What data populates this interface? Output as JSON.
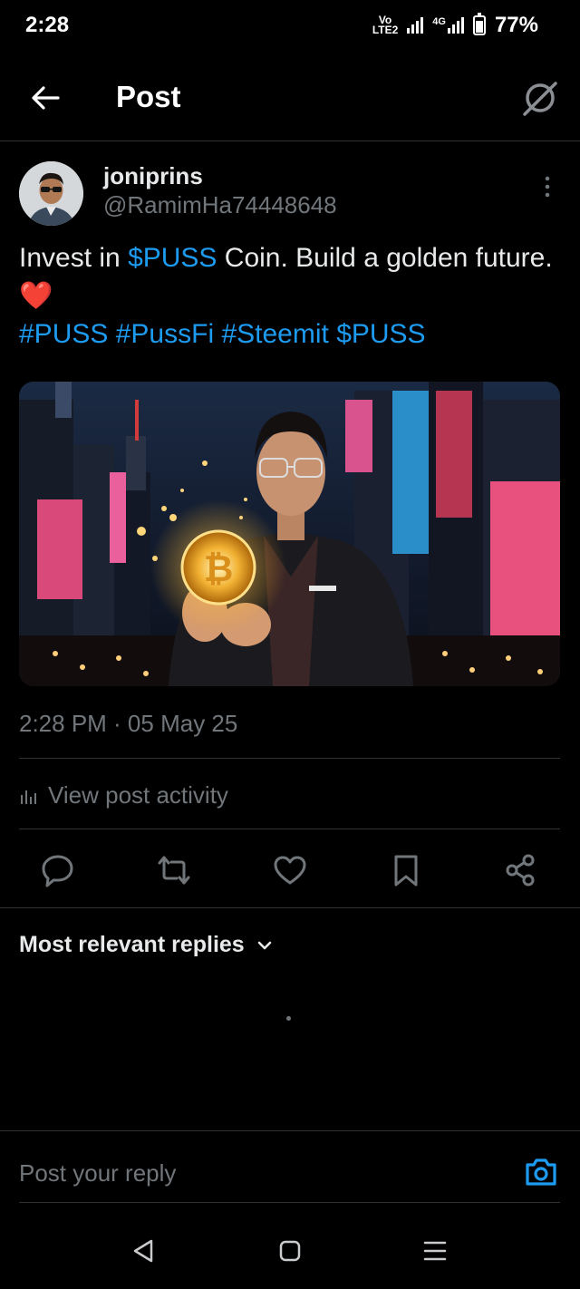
{
  "status_bar": {
    "time": "2:28",
    "network_label_top": "Vo",
    "network_label_bottom": "LTE2",
    "network_4g": "4G",
    "battery_text": "77%"
  },
  "header": {
    "title": "Post",
    "back_icon": "arrow-left-icon",
    "grok_icon": "grok-slash-icon"
  },
  "post": {
    "author_name": "joniprins",
    "author_handle": "@RamimHa74448648",
    "text_parts": {
      "p1": "Invest in ",
      "p2": "$PUSS",
      "p3": " Coin. Build a golden future.",
      "heart": "❤️",
      "tag1": "#PUSS",
      "tag2": "#PussFi",
      "tag3": "#Steemit",
      "tag4": "$PUSS"
    },
    "timestamp": "2:28 PM · 05 May 25",
    "activity_label": "View post activity"
  },
  "actions": [
    "reply-icon",
    "repost-icon",
    "like-icon",
    "bookmark-icon",
    "share-icon"
  ],
  "replies": {
    "sort_label": "Most relevant replies"
  },
  "composer": {
    "placeholder": "Post your reply"
  },
  "colors": {
    "link": "#1d9bf0",
    "muted": "#71767b",
    "divider": "#2f3336",
    "heart": "#e0245e"
  }
}
